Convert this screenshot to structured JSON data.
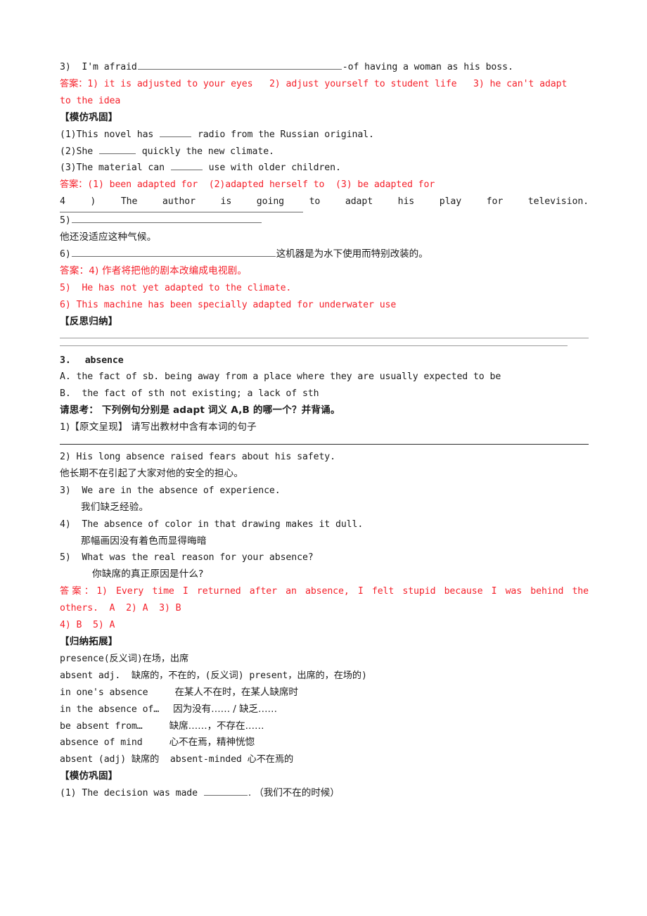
{
  "document": {
    "colors": {
      "answer_red": "#f5202a",
      "body_text": "#1b1b1b",
      "rule_gray": "#9a9a9a"
    },
    "lines": {
      "l01_q3": "3)  I'm afraid",
      "l01_q3_tail": "-of having a woman as his boss.",
      "l02_answer": "答案：1) it is adjusted to your eyes   2) adjust yourself to student life   3) he can't adapt",
      "l03_answer_cont": "to the idea",
      "l04_heading_practice": "【模仿巩固】",
      "l05_p1_a": "(1)This novel has",
      "l05_p1_b": "radio from the Russian original.",
      "l06_p2_a": "(2)She",
      "l06_p2_b": "quickly the new climate.",
      "l07_p3_a": "(3)The material can",
      "l07_p3_b": "use with older children.",
      "l08_answer": "答案：(1) been adapted for  (2)adapted herself to  (3) be adapted for",
      "l09_q4_justified": "4 ) The author is going to adapt his play for television.",
      "l10_q5": "5)",
      "l11_cn_climate": "他还没适应这种气候。",
      "l12_q6": "6)",
      "l12_q6_tail": "这机器是为水下使用而特别改装的。",
      "l13_answer4": "答案：4) 作者将把他的剧本改编成电视剧。",
      "l14_answer5": "5)  He has not yet adapted to the climate.",
      "l15_answer6": "6) This machine has been specially adapted for underwater use",
      "l16_heading_reflect": "【反思归纳】",
      "l17_section_num": "3.",
      "l17_section_word": "absence",
      "l18_defA": "A. the fact of sb. being away from a place where they are usually expected to be",
      "l19_defB": "B.  the fact of sth not existing; a lack of sth",
      "l20_think": "请思考： 下列例句分别是 adapt 词义 A,B 的哪一个？并背诵。",
      "l21_q1_tag": "1)【原文呈现】",
      "l21_q1_text": "请写出教材中含有本词的句子",
      "l22_q2_en": "2) His long absence raised fears about his safety.",
      "l23_q2_cn": "他长期不在引起了大家对他的安全的担心。",
      "l24_q3_en": "3)  We are in the absence of experience.",
      "l25_q3_cn": "我们缺乏经验。",
      "l26_q4_en": "4)  The absence of color in that drawing makes it dull.",
      "l27_q4_cn": "那幅画因没有着色而显得晦暗",
      "l28_q5_en": "5)  What was the real reason for your absence?",
      "l29_q5_cn": "你缺席的真正原因是什么?",
      "l30_answer": "答案：1) Every time I returned after an absence, I felt stupid because I was behind the",
      "l31_answer_cont": "others.  A  2) A  3) B",
      "l32_answer_cont2": "4) B  5) A",
      "l33_heading_extend": "【归纳拓展】",
      "l34_presence": "presence(反义词)在场，出席",
      "l35_absent_adj": "absent adj.  缺席的，不在的，(反义词) present，出席的，在场的)",
      "l36_in_ones_absence_en": "in one's absence",
      "l36_in_ones_absence_cn": "在某人不在时，在某人缺席时",
      "l37_in_the_absence_en": "in the absence of…",
      "l37_in_the_absence_cn": "因为没有…… / 缺乏……",
      "l38_be_absent_from_en": "be absent from…",
      "l38_be_absent_from_cn": "缺席……，不存在……",
      "l39_absence_of_mind_en": "absence of mind",
      "l39_absence_of_mind_cn": "心不在焉，精神恍惚",
      "l40_absent_adj2": "absent (adj) 缺席的  absent-minded 心不在焉的",
      "l41_heading_practice": "【模仿巩固】",
      "l42_p1_a": "(1) The decision was made",
      "l42_p1_b": ". （我们不在的时候）"
    }
  }
}
